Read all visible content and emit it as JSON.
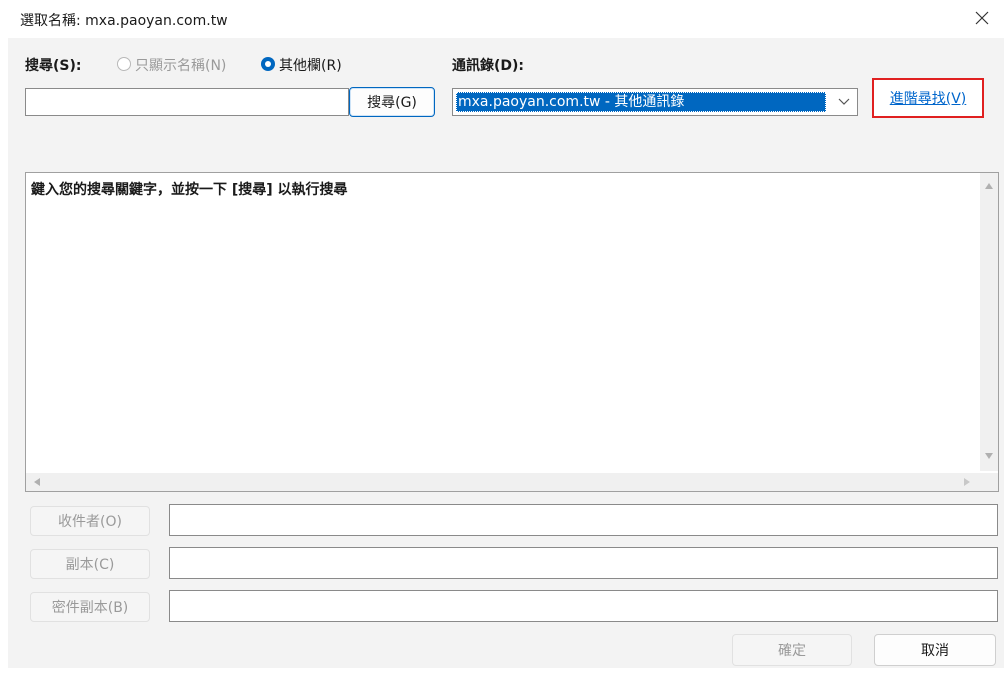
{
  "window": {
    "title": "選取名稱: mxa.paoyan.com.tw"
  },
  "search": {
    "label": "搜尋(S):",
    "radio_name_only": "只顯示名稱(N)",
    "radio_more": "其他欄(R)",
    "selected_radio": "more",
    "input_value": "",
    "button": "搜尋(G)"
  },
  "address_book": {
    "label": "通訊錄(D):",
    "selected": "mxa.paoyan.com.tw - 其他通訊錄"
  },
  "advanced_find": {
    "label": "進階尋找(V)"
  },
  "results": {
    "hint": "鍵入您的搜尋關鍵字，並按一下 [搜尋] 以執行搜尋"
  },
  "recipients": {
    "to_label": "收件者(O)",
    "cc_label": "副本(C)",
    "bcc_label": "密件副本(B)",
    "to_value": "",
    "cc_value": "",
    "bcc_value": ""
  },
  "footer": {
    "ok": "確定",
    "cancel": "取消"
  },
  "colors": {
    "accent": "#0067c0",
    "highlight_box": "#e02020",
    "link": "#0066cc"
  }
}
